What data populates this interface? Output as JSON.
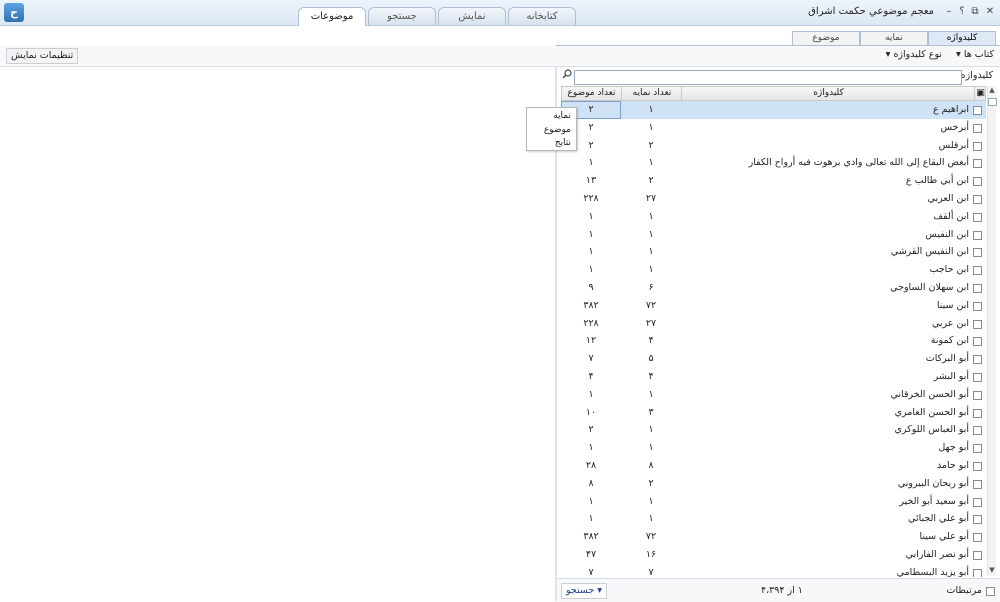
{
  "window": {
    "title": "معجم موضوعي حكمت اشراق",
    "help": "؟",
    "minimize": "–",
    "restore": "⧉",
    "close": "✕",
    "logo": "ح"
  },
  "main_tabs": [
    "موضوعات",
    "جستجو",
    "نمایش",
    "کتابخانه"
  ],
  "sub_tabs": [
    "کلیدواژه",
    "نمایه",
    "موضوع"
  ],
  "toolbar": {
    "books": "کتاب ها",
    "keyword_type": "نوع کلیدواژه",
    "display_settings": "تنظیمات نمایش"
  },
  "keyword_panel": {
    "label": "کلیدواژه",
    "search_value": ""
  },
  "table": {
    "headers": {
      "keyword": "کلیدواژه",
      "index_count": "تعداد نمایه",
      "topic_count": "تعداد موضوع"
    },
    "rows": [
      {
        "name": "ابراهيم ع",
        "index": "۱",
        "topic": "۲"
      },
      {
        "name": "أبرخس",
        "index": "۱",
        "topic": "۲"
      },
      {
        "name": "أبرقلس",
        "index": "۲",
        "topic": "۲"
      },
      {
        "name": "أبغض البقاع إلى الله تعالى وادي برهوت فيه أرواح الكفار",
        "index": "۱",
        "topic": "۱"
      },
      {
        "name": "ابن أبي طالب ع",
        "index": "۲",
        "topic": "۱۳"
      },
      {
        "name": "ابن العربي",
        "index": "۲۷",
        "topic": "۲۲۸"
      },
      {
        "name": "ابن ألقف",
        "index": "۱",
        "topic": "۱"
      },
      {
        "name": "ابن النفيس",
        "index": "۱",
        "topic": "۱"
      },
      {
        "name": "ابن النفيس القرشي",
        "index": "۱",
        "topic": "۱"
      },
      {
        "name": "ابن حاجب",
        "index": "۱",
        "topic": "۱"
      },
      {
        "name": "ابن سهلان الساوجي",
        "index": "۶",
        "topic": "۹"
      },
      {
        "name": "ابن سينا",
        "index": "۷۲",
        "topic": "۳۸۲"
      },
      {
        "name": "ابن عربي",
        "index": "۲۷",
        "topic": "۲۲۸"
      },
      {
        "name": "ابن كمونة",
        "index": "۴",
        "topic": "۱۲"
      },
      {
        "name": "أبو البركات",
        "index": "۵",
        "topic": "۷"
      },
      {
        "name": "أبو البشر",
        "index": "۴",
        "topic": "۴"
      },
      {
        "name": "أبو الحسن الخرقاني",
        "index": "۱",
        "topic": "۱"
      },
      {
        "name": "أبو الحسن العامري",
        "index": "۳",
        "topic": "۱۰"
      },
      {
        "name": "أبو العباس اللوكري",
        "index": "۱",
        "topic": "۲"
      },
      {
        "name": "أبو جهل",
        "index": "۱",
        "topic": "۱"
      },
      {
        "name": "ابو حامد",
        "index": "۸",
        "topic": "۲۸"
      },
      {
        "name": "أبو ريحان البيروني",
        "index": "۲",
        "topic": "۸"
      },
      {
        "name": "أبو سعيد أبو الخير",
        "index": "۱",
        "topic": "۱"
      },
      {
        "name": "أبو علي الجبائي",
        "index": "۱",
        "topic": "۱"
      },
      {
        "name": "أبو علي سينا",
        "index": "۷۲",
        "topic": "۳۸۲"
      },
      {
        "name": "أبو نصر الفارابي",
        "index": "۱۶",
        "topic": "۴۷"
      },
      {
        "name": "أبو يزيد البسطامي",
        "index": "۷",
        "topic": "۷"
      }
    ]
  },
  "context_menu": [
    "نمایه",
    "موضوع",
    "نتایج"
  ],
  "status": {
    "related": "مرتبطات",
    "count": "۱ از ۴،۳۹۴",
    "search": "جستجو"
  }
}
